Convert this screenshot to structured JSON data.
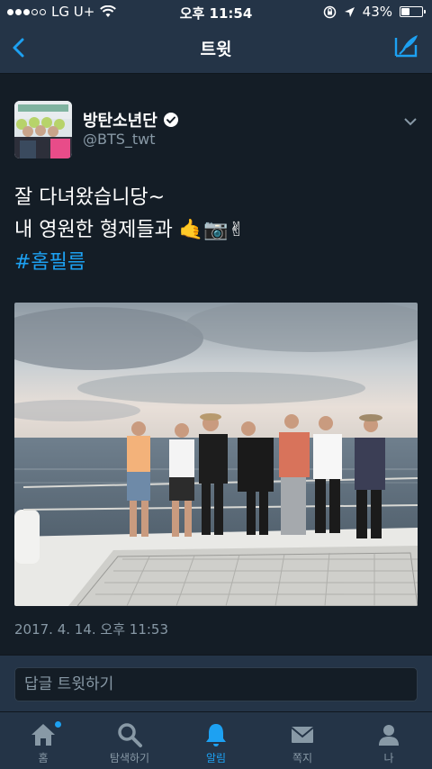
{
  "status_bar": {
    "carrier": "LG U+",
    "time": "오후 11:54",
    "battery": "43%",
    "battery_level": 0.43,
    "signal_bars_filled": 3,
    "signal_bars_total": 5
  },
  "nav": {
    "title": "트윗",
    "back_icon": "chevron-left-icon",
    "compose_icon": "compose-icon"
  },
  "tweet": {
    "author_name": "방탄소년단",
    "author_handle": "@BTS_twt",
    "verified": true,
    "line1": "잘 다녀왔습니당~",
    "line2": "내 영원한 형제들과",
    "line2_emoji": "🤙📷✌",
    "hashtag": "#홈필름",
    "timestamp": "2017. 4. 14. 오후 11:53"
  },
  "reply": {
    "placeholder": "답글 트윗하기"
  },
  "tabs": [
    {
      "label": "홈",
      "icon": "home-icon",
      "active": false,
      "has_dot": true
    },
    {
      "label": "탐색하기",
      "icon": "search-icon",
      "active": false
    },
    {
      "label": "알림",
      "icon": "bell-icon",
      "active": true
    },
    {
      "label": "쪽지",
      "icon": "envelope-icon",
      "active": false
    },
    {
      "label": "나",
      "icon": "person-icon",
      "active": false
    }
  ],
  "colors": {
    "accent": "#1da1f2",
    "background": "#141d26",
    "bar_background": "#243447",
    "secondary_text": "#8899a6"
  }
}
